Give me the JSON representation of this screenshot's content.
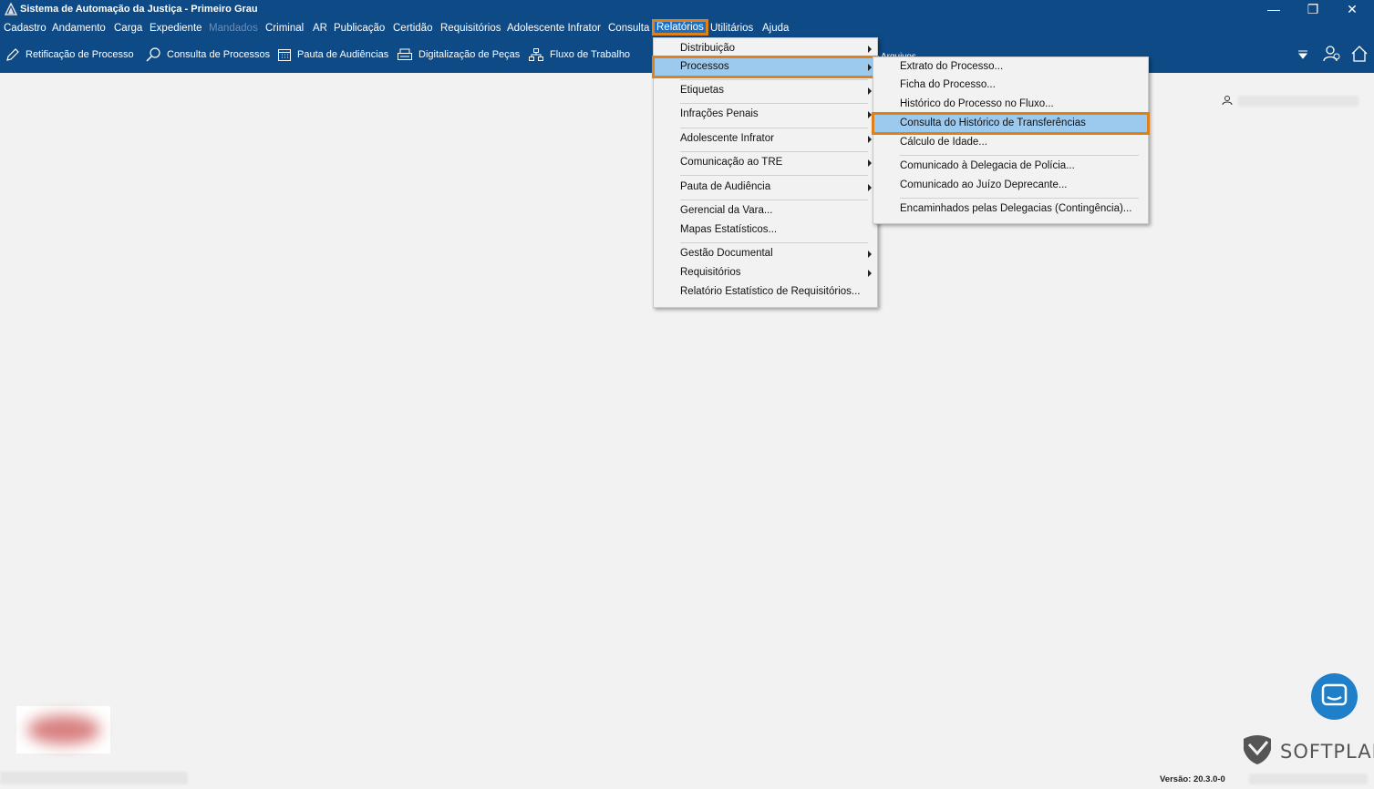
{
  "window": {
    "title": "Sistema de Automação da Justiça - Primeiro Grau",
    "minimize": "—",
    "restore": "❐",
    "close": "✕"
  },
  "menubar": [
    {
      "label": "Cadastro"
    },
    {
      "label": "Andamento"
    },
    {
      "label": "Carga"
    },
    {
      "label": "Expediente"
    },
    {
      "label": "Mandados",
      "disabled": true
    },
    {
      "label": "Criminal"
    },
    {
      "label": "AR"
    },
    {
      "label": "Publicação"
    },
    {
      "label": "Certidão"
    },
    {
      "label": "Requisitórios"
    },
    {
      "label": "Adolescente Infrator"
    },
    {
      "label": "Consulta"
    },
    {
      "label": "Relatórios",
      "active": true
    },
    {
      "label": "Utilitários"
    },
    {
      "label": "Ajuda"
    }
  ],
  "toolbar": {
    "items": [
      {
        "label": "Retificação de Processo",
        "icon": "edit-icon"
      },
      {
        "label": "Consulta de Processos",
        "icon": "search-icon"
      },
      {
        "label": "Pauta de Audiências",
        "icon": "calendar-icon"
      },
      {
        "label": "Digitalização de Peças",
        "icon": "scanner-icon"
      },
      {
        "label": "Fluxo de Trabalho",
        "icon": "workflow-icon"
      }
    ],
    "arquivos_label": "Arquivos"
  },
  "relatorios_menu": [
    {
      "label": "Distribuição",
      "submenu": true
    },
    {
      "label": "Processos",
      "submenu": true,
      "highlighted": true
    },
    {
      "label": "Etiquetas",
      "submenu": true
    },
    {
      "label": "Infrações Penais",
      "submenu": true
    },
    {
      "label": "Adolescente Infrator",
      "submenu": true
    },
    {
      "label": "Comunicação ao TRE",
      "submenu": true
    },
    {
      "label": "Pauta de Audiência",
      "submenu": true
    },
    {
      "label": "Gerencial da Vara..."
    },
    {
      "label": "Mapas Estatísticos..."
    },
    {
      "label": "Gestão Documental",
      "submenu": true
    },
    {
      "label": "Requisitórios",
      "submenu": true
    },
    {
      "label": "Relatório Estatístico de Requisitórios..."
    }
  ],
  "processos_submenu": [
    {
      "label": "Extrato do Processo..."
    },
    {
      "label": "Ficha do Processo..."
    },
    {
      "label": "Histórico do Processo no Fluxo..."
    },
    {
      "label": "Consulta do Histórico de Transferências",
      "highlighted": true
    },
    {
      "label": "Cálculo de Idade..."
    },
    {
      "label": "Comunicado à Delegacia de Polícia..."
    },
    {
      "label": "Comunicado ao Juízo Deprecante..."
    },
    {
      "label": "Encaminhados pelas Delegacias (Contingência)..."
    }
  ],
  "footer": {
    "brand": "SOFTPLAN",
    "version": "Versão: 20.3.0-0"
  },
  "colors": {
    "header_bg": "#0d4a86",
    "highlight_outline": "#e0801a",
    "menu_highlight": "#9cc9ee",
    "chat_button": "#1f7fc9"
  }
}
